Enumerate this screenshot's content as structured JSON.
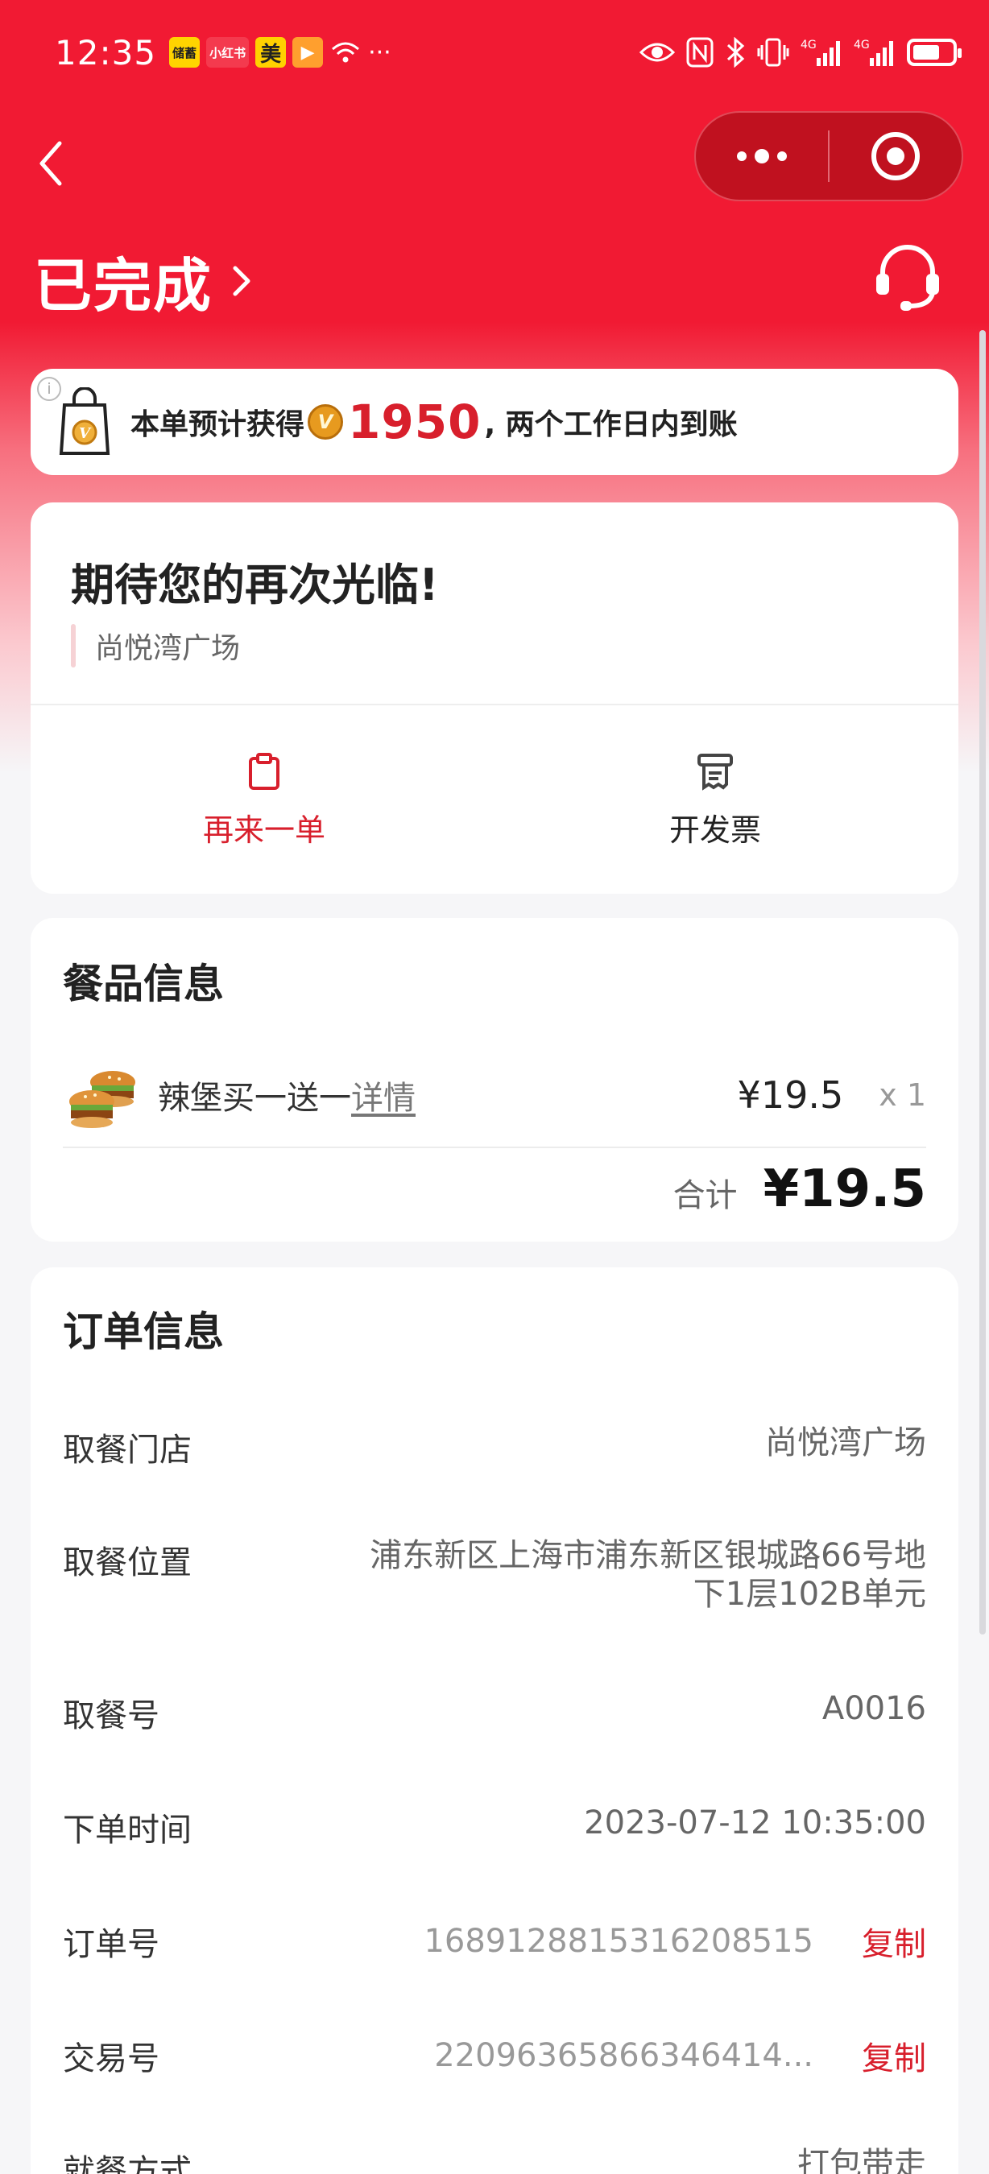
{
  "status_bar": {
    "time": "12:35",
    "apps": [
      {
        "label": "储蓄",
        "bg": "#ffd400",
        "fg": "#222"
      },
      {
        "label": "小红书",
        "bg": "#f43a4e",
        "fg": "#fff"
      },
      {
        "label": "美",
        "bg": "#ffd100",
        "fg": "#222"
      },
      {
        "label": "▶",
        "bg": "#ff9f2e",
        "fg": "#fff"
      }
    ],
    "more": "···",
    "signal1": "4G",
    "signal2": "4G"
  },
  "header": {
    "status_title": "已完成",
    "chevron": "›"
  },
  "points": {
    "prefix": "本单预计获得",
    "coin_letter": "V",
    "amount": "1950",
    "suffix": ", 两个工作日内到账",
    "info_icon": "i"
  },
  "welcome": {
    "title": "期待您的再次光临!",
    "store": "尚悦湾广场",
    "actions": {
      "reorder": "再来一单",
      "invoice": "开发票"
    }
  },
  "meal": {
    "section_title": "餐品信息",
    "items": [
      {
        "name": "辣堡买一送一",
        "detail": "详情",
        "price": "¥19.5",
        "qty": "x 1"
      }
    ],
    "total_label": "合计",
    "total_value": "¥19.5"
  },
  "order": {
    "section_title": "订单信息",
    "rows": {
      "store_label": "取餐门店",
      "store_value": "尚悦湾广场",
      "location_label": "取餐位置",
      "location_value": "浦东新区上海市浦东新区银城路66号地下1层102B单元",
      "pickup_no_label": "取餐号",
      "pickup_no_value": "A0016",
      "time_label": "下单时间",
      "time_value": "2023-07-12 10:35:00",
      "order_no_label": "订单号",
      "order_no_value": "1689128815316208515",
      "trade_no_label": "交易号",
      "trade_no_value": "22096365866346414...",
      "dine_label": "就餐方式",
      "dine_value": "打包带走",
      "copy_label": "复制"
    }
  }
}
